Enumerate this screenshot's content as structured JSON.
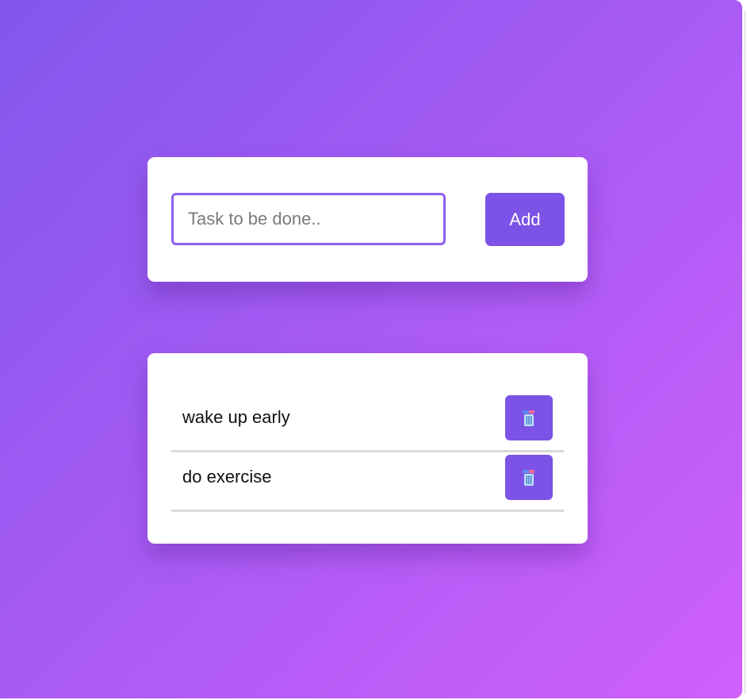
{
  "colors": {
    "gradient_start": "#8257ec",
    "gradient_end": "#d05ffc",
    "accent": "#7c53e6"
  },
  "task_input": {
    "value": "",
    "placeholder": "Task to be done.."
  },
  "add_button": {
    "label": "Add"
  },
  "tasks": [
    {
      "text": "wake up early",
      "delete_icon": "trash-icon"
    },
    {
      "text": "do exercise",
      "delete_icon": "trash-icon"
    }
  ]
}
